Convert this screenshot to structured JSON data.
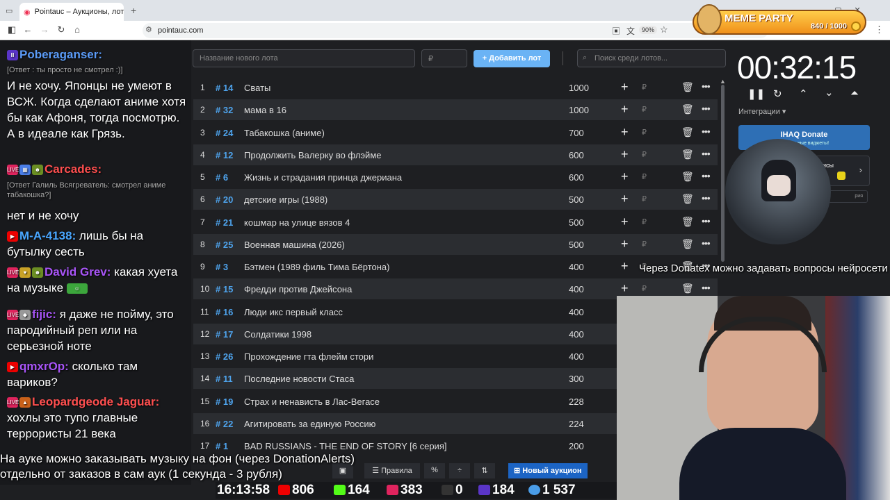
{
  "browser": {
    "tab_title": "Pointauc – Аукционы, лотереи",
    "url": "pointauc.com",
    "zoom": "90%"
  },
  "meme_party": {
    "title": "MEME PARTY",
    "progress": "840 / 1000"
  },
  "chat": [
    {
      "nick": "Poberaganser:",
      "nick_color": "#5b9bf7",
      "reply": "",
      "text": "[Ответ : ты просто не смотрел :)]"
    },
    {
      "nick": "",
      "nick_color": "",
      "reply": "",
      "text": "И не хочу. Японцы не умеют в ВСЖ. Когда сделают аниме хотя бы как Афоня, тогда посмотрю. А в идеале как Грязь."
    },
    {
      "nick": "Carcades:",
      "nick_color": "#ff4f4f",
      "reply": "[Ответ Галиль Всягреватель: смотрел аниме табакошка?]",
      "text": "нет и не хочу"
    },
    {
      "nick": "M-A-4138:",
      "nick_color": "#4aa7ff",
      "reply": "",
      "text": "лишь бы на бутылку сесть"
    },
    {
      "nick": "David Grev:",
      "nick_color": "#a855f7",
      "reply": "",
      "text": "какая хуета на музыке"
    },
    {
      "nick": "fijic:",
      "nick_color": "#a855f7",
      "reply": "",
      "text": "я даже не пойму, это пародийный реп или на серьезной ноте"
    },
    {
      "nick": "qmxrOp:",
      "nick_color": "#a855f7",
      "reply": "",
      "text": "сколько там вариков?"
    },
    {
      "nick": "Leopardgeode Jaguar:",
      "nick_color": "#ff4f4f",
      "reply": "",
      "text": "хохлы это тупо главные террористы 21 века"
    }
  ],
  "toolbar": {
    "lot_placeholder": "Название нового лота",
    "amount_placeholder": "₽",
    "add_label": "Добавить лот",
    "search_placeholder": "Поиск среди лотов..."
  },
  "lots": [
    {
      "n": "1",
      "id": "# 14",
      "name": "Сваты",
      "amount": "1000"
    },
    {
      "n": "2",
      "id": "# 32",
      "name": "мама в 16",
      "amount": "1000"
    },
    {
      "n": "3",
      "id": "# 24",
      "name": "Табакошка (аниме)",
      "amount": "700"
    },
    {
      "n": "4",
      "id": "# 12",
      "name": "Продолжить Валерку во флэйме",
      "amount": "600"
    },
    {
      "n": "5",
      "id": "# 6",
      "name": "Жизнь и страдания принца джериана",
      "amount": "600"
    },
    {
      "n": "6",
      "id": "# 20",
      "name": "детские игры (1988)",
      "amount": "500"
    },
    {
      "n": "7",
      "id": "# 21",
      "name": "кошмар на улице вязов 4",
      "amount": "500"
    },
    {
      "n": "8",
      "id": "# 25",
      "name": "Военная машина (2026)",
      "amount": "500"
    },
    {
      "n": "9",
      "id": "# 3",
      "name": "Бэтмен (1989 филь Тима Бёртона)",
      "amount": "400"
    },
    {
      "n": "10",
      "id": "# 15",
      "name": "Фредди против Джейсона",
      "amount": "400"
    },
    {
      "n": "11",
      "id": "# 16",
      "name": "Люди икс первый класс",
      "amount": "400"
    },
    {
      "n": "12",
      "id": "# 17",
      "name": "Солдатики 1998",
      "amount": "400"
    },
    {
      "n": "13",
      "id": "# 26",
      "name": "Прохождение гта флейм стори",
      "amount": "400"
    },
    {
      "n": "14",
      "id": "# 11",
      "name": "Последние новости Стаса",
      "amount": "300"
    },
    {
      "n": "15",
      "id": "# 19",
      "name": "Страх и ненависть в Лас-Вегасе",
      "amount": "228"
    },
    {
      "n": "16",
      "id": "# 22",
      "name": "Агитировать за единую Россию",
      "amount": "224"
    },
    {
      "n": "17",
      "id": "# 1",
      "name": "BAD RUSSIANS - THE END OF STORY [6 серия]",
      "amount": "200"
    }
  ],
  "currency": "₽",
  "bottom": {
    "rules": "Правила",
    "new_auction": "Новый аукцион"
  },
  "timer": {
    "value": "00:32:15",
    "integrations": "Интеграции"
  },
  "ihaq": {
    "title": "IHAQ Donate",
    "subtitle": "уникальные виджеты!",
    "services": "исы",
    "history": "рия"
  },
  "notices": {
    "donatex": "Через Donatex можно задавать вопросы нейросети",
    "music_line1": "На ауке можно заказывать музыку на фон (через DonationAlerts)",
    "music_line2": "отдельно от заказов в сам аук (1 секунда - 3 рубля)"
  },
  "stats": {
    "time": "16:13:58",
    "youtube": "806",
    "kick": "164",
    "live": "383",
    "r": "0",
    "twitch": "184",
    "viewers": "1 537"
  }
}
